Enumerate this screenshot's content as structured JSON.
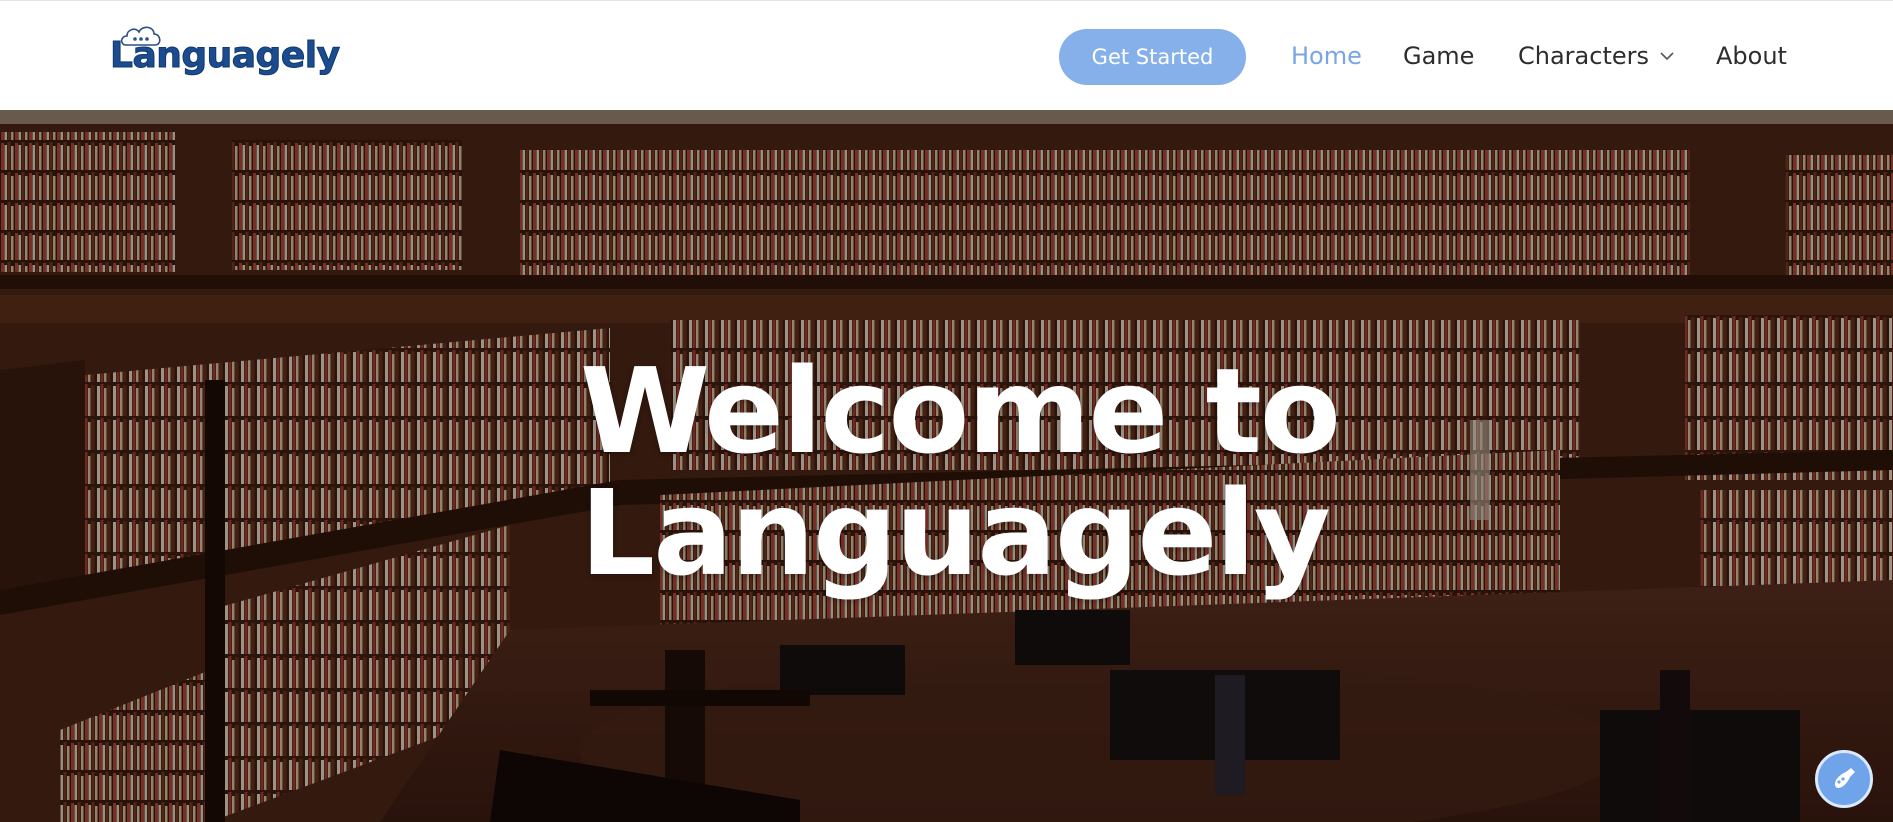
{
  "brand": {
    "name": "Languagely",
    "logo_icon": "speech-cloud-icon",
    "primary_color": "#1b4c8f"
  },
  "header": {
    "cta_label": "Get Started",
    "nav": {
      "home": "Home",
      "game": "Game",
      "characters": "Characters",
      "about": "About"
    },
    "active_nav": "Home",
    "active_color": "#78a6e4",
    "cta_color": "#86b0ea"
  },
  "hero": {
    "title_line1": "Welcome to",
    "title_line2": "Languagely",
    "background": "library-bookshelves-photo"
  },
  "floating_button": {
    "icon": "paint-brush-icon"
  }
}
